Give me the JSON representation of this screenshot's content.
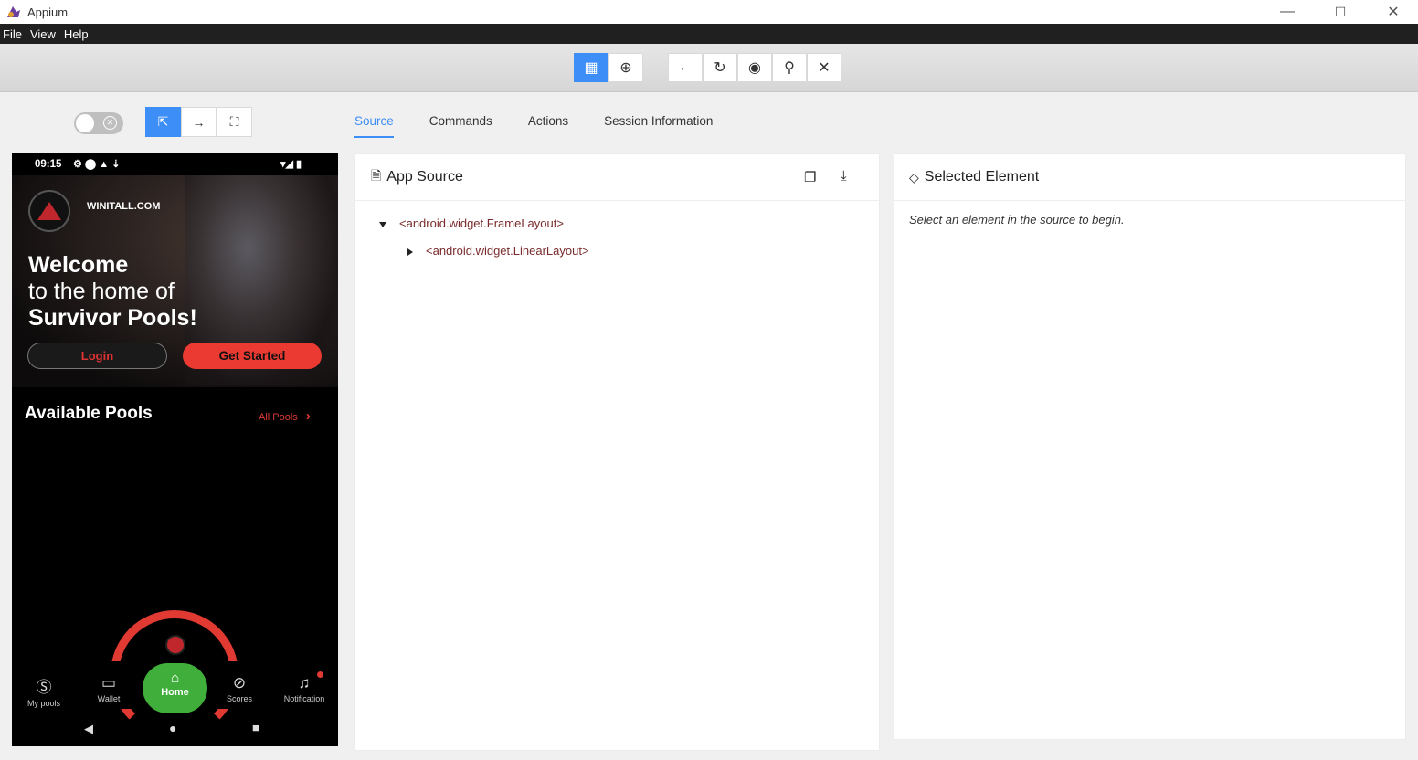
{
  "window": {
    "title": "Appium",
    "minimize_glyph": "—",
    "maximize_glyph": "☐",
    "close_glyph": "✕"
  },
  "menu": [
    "File",
    "View",
    "Help"
  ],
  "toolbar": {
    "view_buttons": [
      {
        "icon": "grid-icon",
        "glyph": "▦",
        "active": true
      },
      {
        "icon": "globe-icon",
        "glyph": "⊕",
        "active": false
      }
    ],
    "action_buttons": [
      {
        "icon": "back-arrow-icon",
        "glyph": "←"
      },
      {
        "icon": "refresh-icon",
        "glyph": "↻"
      },
      {
        "icon": "eye-icon",
        "glyph": "◉"
      },
      {
        "icon": "search-icon",
        "glyph": "⚲"
      },
      {
        "icon": "close-icon",
        "glyph": "✕"
      }
    ]
  },
  "mode_buttons": [
    {
      "icon": "select-element-icon",
      "glyph": "⇱",
      "active": true
    },
    {
      "icon": "swipe-icon",
      "glyph": "→",
      "active": false
    },
    {
      "icon": "tap-coordinates-icon",
      "glyph": "⛶",
      "active": false
    }
  ],
  "tabs": [
    "Source",
    "Commands",
    "Actions",
    "Session Information"
  ],
  "active_tab": "Source",
  "device": {
    "status_time": "09:15",
    "status_left_icons": "⚙ ⬤ ▲ ⇣",
    "status_right_icons": "▾◢ ▮",
    "brand": "WINITALL.COM",
    "welcome_line1": "Welcome",
    "welcome_line2": "to the home of",
    "welcome_line3": "Survivor Pools!",
    "login_label": "Login",
    "get_started_label": "Get Started",
    "pools_title": "Available Pools",
    "all_pools_label": "All Pools",
    "all_pools_chevron": "›",
    "nav": [
      {
        "label": "My pools",
        "glyph": "Ⓢ"
      },
      {
        "label": "Wallet",
        "glyph": "▭"
      },
      {
        "label": "Home",
        "glyph": "⌂"
      },
      {
        "label": "Scores",
        "glyph": "⊘"
      },
      {
        "label": "Notification",
        "glyph": "♫"
      }
    ],
    "sys_back": "◀",
    "sys_home": "●",
    "sys_recent": "■"
  },
  "source_panel": {
    "title": "App Source",
    "title_glyph": "🗎",
    "copy_glyph": "❐",
    "download_glyph": "⤓",
    "tree": [
      {
        "label": "<android.widget.FrameLayout>",
        "expanded": true,
        "depth": 0
      },
      {
        "label": "<android.widget.LinearLayout>",
        "expanded": false,
        "depth": 1
      }
    ]
  },
  "selected_panel": {
    "title": "Selected Element",
    "title_glyph": "◇",
    "hint": "Select an element in the source to begin."
  },
  "colors": {
    "accent": "#3e8ef7",
    "menu_bg": "#202020",
    "brand_red": "#ea3a32",
    "home_green": "#3fae3a"
  }
}
